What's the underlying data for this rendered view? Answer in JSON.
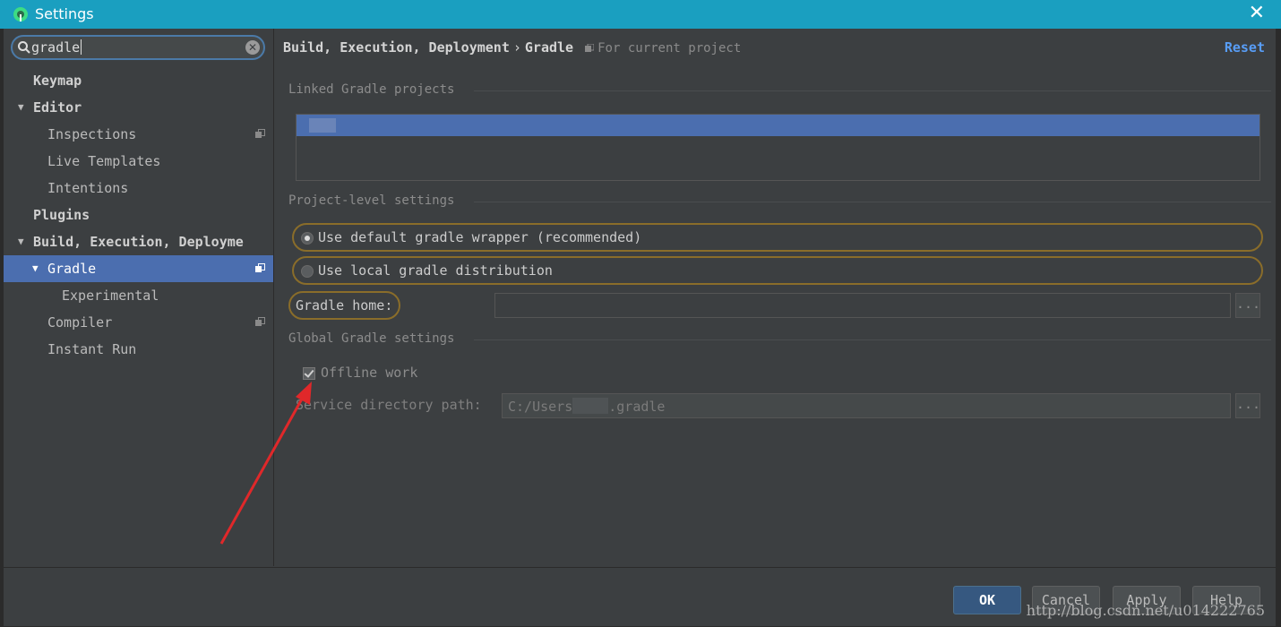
{
  "window": {
    "title": "Settings"
  },
  "search": {
    "value": "gradle"
  },
  "tree": [
    {
      "label": "Keymap",
      "bold": true,
      "level": 0,
      "arrow": ""
    },
    {
      "label": "Editor",
      "bold": true,
      "level": 0,
      "arrow": "▼"
    },
    {
      "label": "Inspections",
      "bold": false,
      "level": 1,
      "arrow": "",
      "copy": true
    },
    {
      "label": "Live Templates",
      "bold": false,
      "level": 1,
      "arrow": ""
    },
    {
      "label": "Intentions",
      "bold": false,
      "level": 1,
      "arrow": ""
    },
    {
      "label": "Plugins",
      "bold": true,
      "level": 0,
      "arrow": ""
    },
    {
      "label": "Build, Execution, Deployme",
      "bold": true,
      "level": 0,
      "arrow": "▼"
    },
    {
      "label": "Gradle",
      "bold": false,
      "level": 1,
      "arrow": "▼",
      "selected": true,
      "copy": true
    },
    {
      "label": "Experimental",
      "bold": false,
      "level": 2,
      "arrow": ""
    },
    {
      "label": "Compiler",
      "bold": false,
      "level": 1,
      "arrow": "",
      "copy": true
    },
    {
      "label": "Instant Run",
      "bold": false,
      "level": 1,
      "arrow": ""
    }
  ],
  "breadcrumb": {
    "parent": "Build, Execution, Deployment",
    "sep": "›",
    "current": "Gradle",
    "scope": "For current project"
  },
  "reset_label": "Reset",
  "sections": {
    "linked": "Linked Gradle projects",
    "project": "Project-level settings",
    "global": "Global Gradle settings"
  },
  "options": {
    "default_wrapper": "Use default gradle wrapper (recommended)",
    "local_dist": "Use local gradle distribution",
    "gradle_home_label": "Gradle home:",
    "offline_work": "Offline work",
    "service_dir_label": "Service directory path:",
    "service_dir_prefix": "C:/Users",
    "service_dir_suffix": ".gradle",
    "browse": "..."
  },
  "buttons": {
    "ok": "OK",
    "cancel": "Cancel",
    "apply": "Apply",
    "help": "Help"
  },
  "watermark": "http://blog.csdn.net/u014222765",
  "colors": {
    "titlebar": "#1a9fc0",
    "selection": "#4b6eaf",
    "link": "#589df6",
    "highlight_border": "#8a6d2a",
    "annotation_arrow": "#e0282a"
  }
}
